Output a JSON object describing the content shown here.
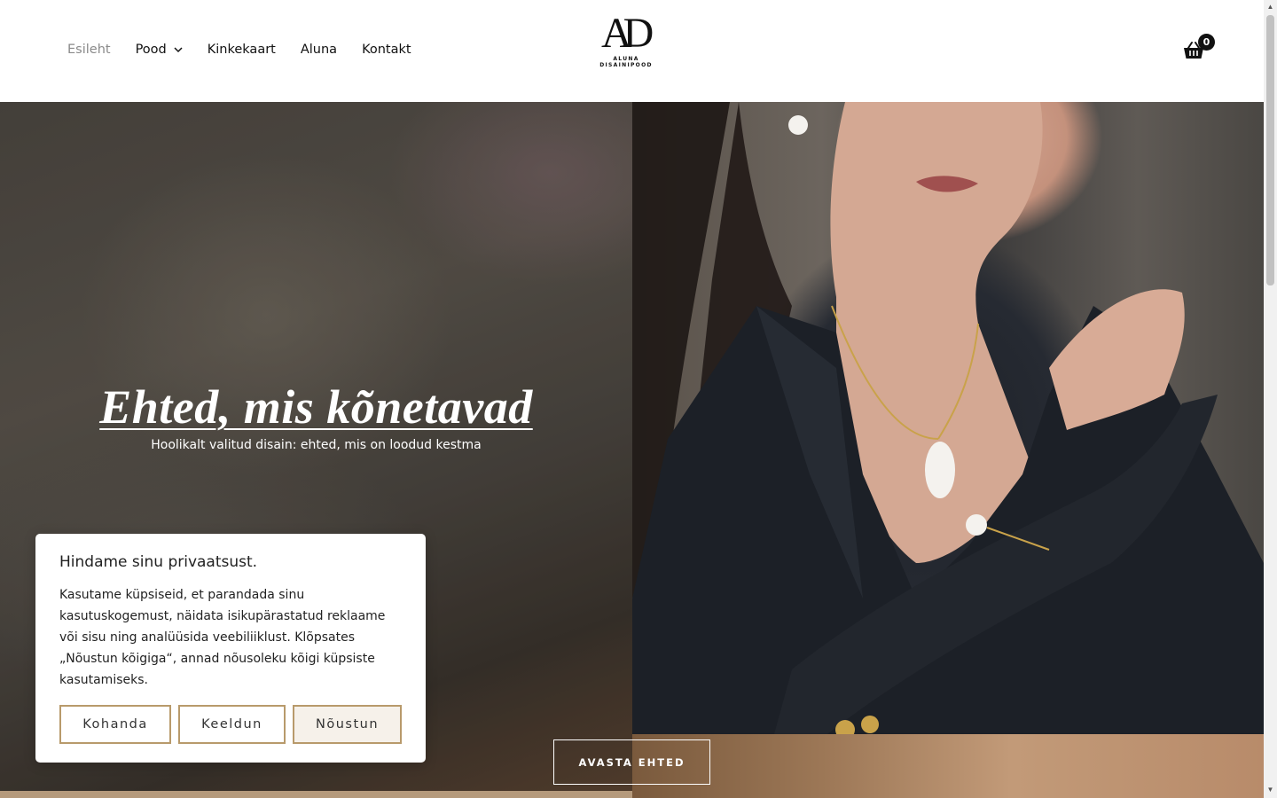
{
  "header": {
    "nav": [
      {
        "label": "Esileht"
      },
      {
        "label": "Pood"
      },
      {
        "label": "Kinkekaart"
      },
      {
        "label": "Aluna"
      },
      {
        "label": "Kontakt"
      }
    ],
    "logo": {
      "monogram": "AD",
      "subtitle": "ALUNA DISAINIPOOD"
    },
    "cart": {
      "count": "0",
      "icon": "basket-icon"
    }
  },
  "hero": {
    "title": "Ehted, mis kõnetavad",
    "subtitle": "Hoolikalt valitud disain: ehted, mis on loodud kestma",
    "cta": "AVASTA EHTED"
  },
  "cookie": {
    "title": "Hindame sinu privaatsust.",
    "text": "Kasutame küpsiseid, et parandada sinu kasutuskogemust, näidata isikupärastatud reklaame või sisu ning analüüsida veebiliiklust. Klõpsates „Nõustun kõigiga“, annad nõusoleku kõigi küpsiste kasutamiseks.",
    "buttons": {
      "customize": "Kohanda",
      "decline": "Keeldun",
      "accept": "Nõustun"
    }
  },
  "colors": {
    "accent": "#b89a6b",
    "text": "#111111",
    "muted": "#8a8a8a"
  }
}
